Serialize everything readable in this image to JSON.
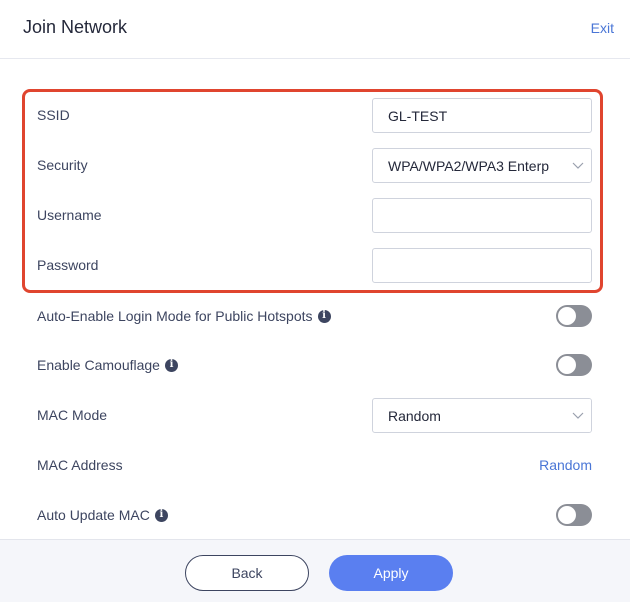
{
  "header": {
    "title": "Join Network",
    "exit_label": "Exit"
  },
  "form": {
    "ssid": {
      "label": "SSID",
      "value": "GL-TEST"
    },
    "security": {
      "label": "Security",
      "value": "WPA/WPA2/WPA3 Enterp"
    },
    "username": {
      "label": "Username",
      "value": ""
    },
    "password": {
      "label": "Password",
      "value": ""
    }
  },
  "options": {
    "auto_login": {
      "label": "Auto-Enable Login Mode for Public Hotspots",
      "enabled": false
    },
    "camouflage": {
      "label": "Enable Camouflage",
      "enabled": false
    },
    "mac_mode": {
      "label": "MAC Mode",
      "value": "Random"
    },
    "mac_address": {
      "label": "MAC Address",
      "value": "Random"
    },
    "auto_update_mac": {
      "label": "Auto Update MAC",
      "enabled": false
    }
  },
  "footer": {
    "back_label": "Back",
    "apply_label": "Apply"
  },
  "colors": {
    "accent": "#5a7ff0",
    "link": "#4a76d6",
    "highlight": "#e0452f",
    "toggle_off": "#8b8e96"
  },
  "icons": [
    "info-icon",
    "chevron-down-icon"
  ]
}
